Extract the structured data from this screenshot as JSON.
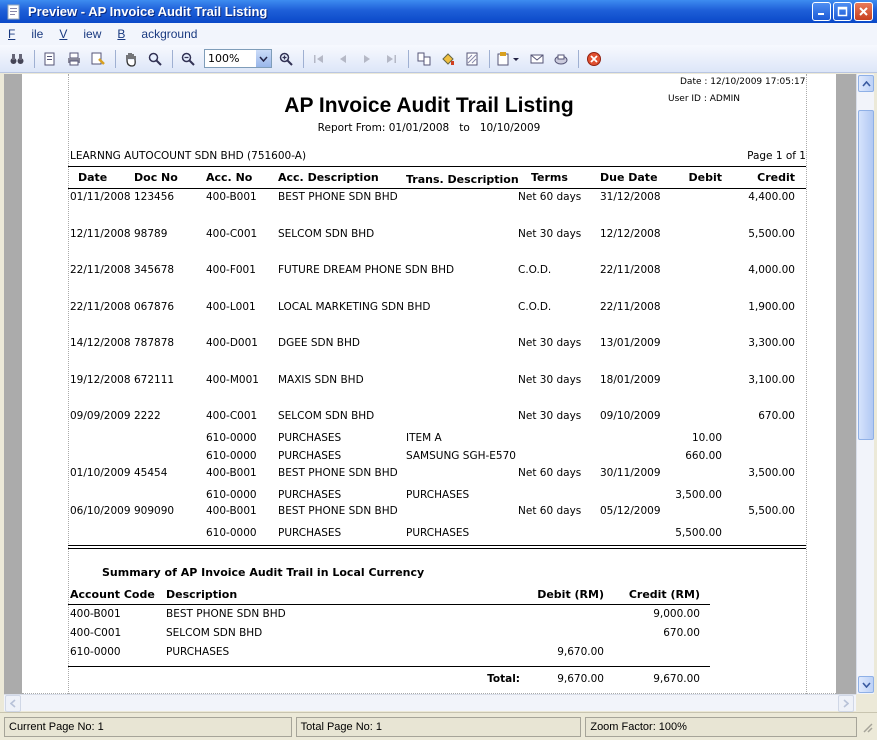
{
  "window": {
    "title": "Preview - AP Invoice Audit Trail Listing"
  },
  "menu": [
    {
      "key": "F",
      "rest": "ile"
    },
    {
      "key": "V",
      "rest": "iew"
    },
    {
      "key": "B",
      "rest": "ackground"
    }
  ],
  "toolbar": {
    "zoom": "100%"
  },
  "report": {
    "date_label": "Date :",
    "date_value": "12/10/2009 17:05:17",
    "user_label": "User ID :",
    "user_value": "ADMIN",
    "title": "AP Invoice Audit Trail Listing",
    "report_from_label": "Report From:",
    "report_from": "01/01/2008",
    "to_label": "to",
    "report_to": "10/10/2009",
    "company": "LEARNNG AUTOCOUNT SDN BHD (751600-A)",
    "page_info": "Page 1 of 1",
    "columns": [
      "Date",
      "Doc No",
      "Acc. No",
      "Acc. Description",
      "Trans. Description",
      "Terms",
      "Due Date",
      "Debit",
      "Credit"
    ],
    "rows": [
      {
        "date": "01/11/2008",
        "doc": "123456",
        "acc": "400-B001",
        "desc": "BEST PHONE SDN BHD",
        "trans": "",
        "terms": "Net 60 days",
        "due": "31/12/2008",
        "debit": "",
        "credit": "4,400.00"
      },
      {
        "date": "12/11/2008",
        "doc": "98789",
        "acc": "400-C001",
        "desc": "SELCOM SDN BHD",
        "trans": "",
        "terms": "Net 30 days",
        "due": "12/12/2008",
        "debit": "",
        "credit": "5,500.00"
      },
      {
        "date": "22/11/2008",
        "doc": "345678",
        "acc": "400-F001",
        "desc": "FUTURE DREAM PHONE SDN BHD",
        "trans": "",
        "terms": "C.O.D.",
        "due": "22/11/2008",
        "debit": "",
        "credit": "4,000.00"
      },
      {
        "date": "22/11/2008",
        "doc": "067876",
        "acc": "400-L001",
        "desc": "LOCAL MARKETING SDN BHD",
        "trans": "",
        "terms": "C.O.D.",
        "due": "22/11/2008",
        "debit": "",
        "credit": "1,900.00"
      },
      {
        "date": "14/12/2008",
        "doc": "787878",
        "acc": "400-D001",
        "desc": "DGEE SDN BHD",
        "trans": "",
        "terms": "Net 30 days",
        "due": "13/01/2009",
        "debit": "",
        "credit": "3,300.00"
      },
      {
        "date": "19/12/2008",
        "doc": "672111",
        "acc": "400-M001",
        "desc": "MAXIS SDN BHD",
        "trans": "",
        "terms": "Net 30 days",
        "due": "18/01/2009",
        "debit": "",
        "credit": "3,100.00"
      },
      {
        "date": "09/09/2009",
        "doc": "2222",
        "acc": "400-C001",
        "desc": "SELCOM SDN BHD",
        "trans": "",
        "terms": "Net 30 days",
        "due": "09/10/2009",
        "debit": "",
        "credit": "670.00"
      },
      {
        "date": "",
        "doc": "",
        "acc": "610-0000",
        "desc": "PURCHASES",
        "trans": "ITEM A",
        "terms": "",
        "due": "",
        "debit": "10.00",
        "credit": ""
      },
      {
        "date": "",
        "doc": "",
        "acc": "610-0000",
        "desc": "PURCHASES",
        "trans": "SAMSUNG SGH-E570",
        "terms": "",
        "due": "",
        "debit": "660.00",
        "credit": ""
      },
      {
        "date": "01/10/2009",
        "doc": "45454",
        "acc": "400-B001",
        "desc": "BEST PHONE SDN BHD",
        "trans": "",
        "terms": "Net 60 days",
        "due": "30/11/2009",
        "debit": "",
        "credit": "3,500.00"
      },
      {
        "date": "",
        "doc": "",
        "acc": "610-0000",
        "desc": "PURCHASES",
        "trans": "PURCHASES",
        "terms": "",
        "due": "",
        "debit": "3,500.00",
        "credit": ""
      },
      {
        "date": "06/10/2009",
        "doc": "909090",
        "acc": "400-B001",
        "desc": "BEST PHONE SDN BHD",
        "trans": "",
        "terms": "Net 60 days",
        "due": "05/12/2009",
        "debit": "",
        "credit": "5,500.00"
      },
      {
        "date": "",
        "doc": "",
        "acc": "610-0000",
        "desc": "PURCHASES",
        "trans": "PURCHASES",
        "terms": "",
        "due": "",
        "debit": "5,500.00",
        "credit": ""
      }
    ],
    "summary": {
      "title": "Summary of AP Invoice Audit Trail in Local Currency",
      "columns": [
        "Account Code",
        "Description",
        "Debit (RM)",
        "Credit (RM)"
      ],
      "rows": [
        {
          "code": "400-B001",
          "desc": "BEST PHONE SDN BHD",
          "debit": "",
          "credit": "9,000.00"
        },
        {
          "code": "400-C001",
          "desc": "SELCOM SDN BHD",
          "debit": "",
          "credit": "670.00"
        },
        {
          "code": "610-0000",
          "desc": "PURCHASES",
          "debit": "9,670.00",
          "credit": ""
        }
      ],
      "total_label": "Total:",
      "total_debit": "9,670.00",
      "total_credit": "9,670.00"
    }
  },
  "status": {
    "current_page": "Current Page No: 1",
    "total_page": "Total Page No: 1",
    "zoom_factor": "Zoom Factor: 100%"
  }
}
